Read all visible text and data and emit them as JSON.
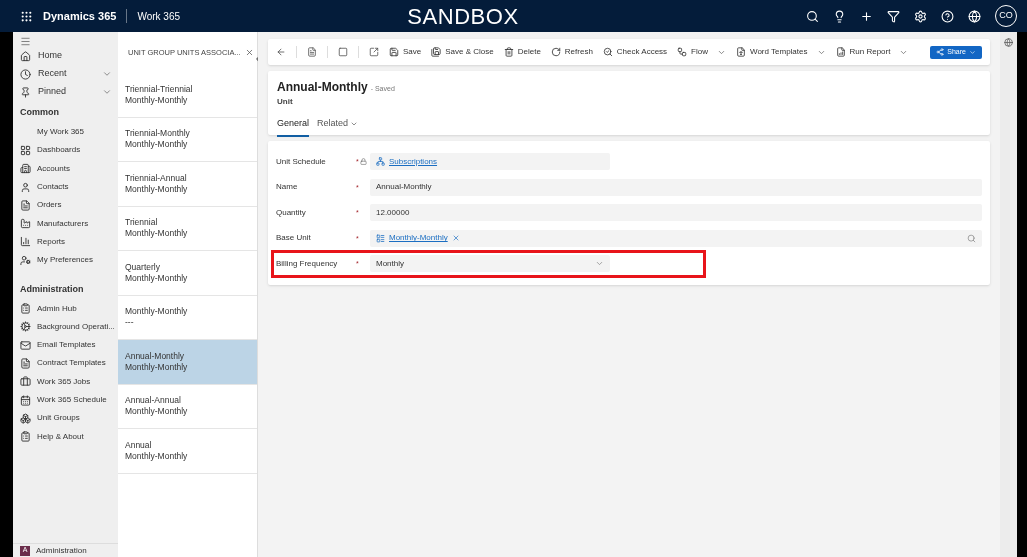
{
  "topbar": {
    "app": "Dynamics 365",
    "area": "Work 365",
    "env": "SANDBOX",
    "avatar": "CO"
  },
  "nav": {
    "home": "Home",
    "groups_top": [
      {
        "label": "Recent",
        "expanded": false
      },
      {
        "label": "Pinned",
        "expanded": false
      }
    ],
    "sections": [
      {
        "title": "Common",
        "items": [
          {
            "label": "My Work 365"
          },
          {
            "label": "Dashboards"
          },
          {
            "label": "Accounts"
          },
          {
            "label": "Contacts"
          },
          {
            "label": "Orders"
          },
          {
            "label": "Manufacturers"
          },
          {
            "label": "Reports"
          },
          {
            "label": "My Preferences"
          }
        ]
      },
      {
        "title": "Administration",
        "items": [
          {
            "label": "Admin Hub"
          },
          {
            "label": "Background Operati..."
          },
          {
            "label": "Email Templates"
          },
          {
            "label": "Contract Templates"
          },
          {
            "label": "Work 365 Jobs"
          },
          {
            "label": "Work 365 Schedule"
          },
          {
            "label": "Unit Groups"
          },
          {
            "label": "Help & About"
          }
        ]
      }
    ],
    "area_switcher": {
      "letter": "A",
      "label": "Administration"
    }
  },
  "list": {
    "title": "UNIT GROUP UNITS ASSOCIA...",
    "items": [
      {
        "line1": "Triennial-Triennial",
        "line2": "Monthly-Monthly",
        "selected": false
      },
      {
        "line1": "Triennial-Monthly",
        "line2": "Monthly-Monthly",
        "selected": false
      },
      {
        "line1": "Triennial-Annual",
        "line2": "Monthly-Monthly",
        "selected": false
      },
      {
        "line1": "Triennial",
        "line2": "Monthly-Monthly",
        "selected": false
      },
      {
        "line1": "Quarterly",
        "line2": "Monthly-Monthly",
        "selected": false
      },
      {
        "line1": "Monthly-Monthly",
        "line2": "---",
        "selected": false
      },
      {
        "line1": "Annual-Monthly",
        "line2": "Monthly-Monthly",
        "selected": true
      },
      {
        "line1": "Annual-Annual",
        "line2": "Monthly-Monthly",
        "selected": false
      },
      {
        "line1": "Annual",
        "line2": "Monthly-Monthly",
        "selected": false
      }
    ]
  },
  "toolbar": {
    "commands": [
      {
        "label": "Save",
        "dropdown": false
      },
      {
        "label": "Save & Close",
        "dropdown": false
      },
      {
        "label": "Delete",
        "dropdown": false
      },
      {
        "label": "Refresh",
        "dropdown": false
      },
      {
        "label": "Check Access",
        "dropdown": false
      },
      {
        "label": "Flow",
        "dropdown": true
      },
      {
        "label": "Word Templates",
        "dropdown": true
      },
      {
        "label": "Run Report",
        "dropdown": true
      }
    ],
    "share": "Share"
  },
  "record": {
    "title": "Annual-Monthly",
    "status": "- Saved",
    "entity": "Unit",
    "tabs": [
      {
        "label": "General",
        "selected": true
      },
      {
        "label": "Related",
        "selected": false
      }
    ]
  },
  "fields": [
    {
      "label": "Unit Schedule",
      "kind": "lookup",
      "value": "Subscriptions",
      "required_mark": "*",
      "locked": true,
      "highlighted": false
    },
    {
      "label": "Name",
      "kind": "text",
      "value": "Annual-Monthly",
      "required_mark": "*",
      "locked": false,
      "highlighted": false
    },
    {
      "label": "Quantity",
      "kind": "text",
      "value": "12.00000",
      "required_mark": "*",
      "locked": false,
      "highlighted": false
    },
    {
      "label": "Base Unit",
      "kind": "tag",
      "value": "Monthly-Monthly",
      "required_mark": "*",
      "locked": false,
      "highlighted": false
    },
    {
      "label": "Billing Frequency",
      "kind": "select",
      "value": "Monthly",
      "required_mark": "*",
      "locked": false,
      "highlighted": true
    }
  ]
}
